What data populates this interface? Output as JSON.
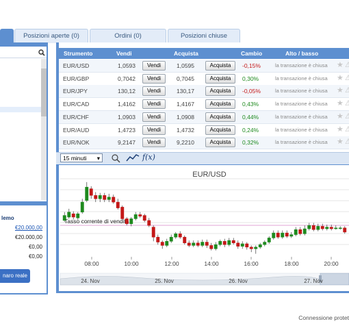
{
  "tabs": [
    "Posizioni aperte (0)",
    "Ordini (0)",
    "Posizioni chiuse"
  ],
  "table": {
    "headers": [
      "Strumento",
      "Vendi",
      "Acquista",
      "Cambio",
      "Alto / basso"
    ],
    "sell_label": "Vendi",
    "buy_label": "Acquista",
    "rows": [
      {
        "symbol": "EUR/USD",
        "sell": "1,0593",
        "buy": "1,0595",
        "change": "-0,15%",
        "note": "la transazione è chiusa"
      },
      {
        "symbol": "EUR/GBP",
        "sell": "0,7042",
        "buy": "0,7045",
        "change": "0,30%",
        "note": "la transazione è chiusa"
      },
      {
        "symbol": "EUR/JPY",
        "sell": "130,12",
        "buy": "130,17",
        "change": "-0,05%",
        "note": "la transazione è chiusa"
      },
      {
        "symbol": "EUR/CAD",
        "sell": "1,4162",
        "buy": "1,4167",
        "change": "0,43%",
        "note": "la transazione è chiusa"
      },
      {
        "symbol": "EUR/CHF",
        "sell": "1,0903",
        "buy": "1,0908",
        "change": "0,44%",
        "note": "la transazione è chiusa"
      },
      {
        "symbol": "EUR/AUD",
        "sell": "1,4723",
        "buy": "1,4732",
        "change": "0,24%",
        "note": "la transazione è chiusa"
      },
      {
        "symbol": "EUR/NOK",
        "sell": "9,2147",
        "buy": "9,2210",
        "change": "0,32%",
        "note": "la transazione è chiusa"
      }
    ]
  },
  "chart_toolbar": {
    "timeframe": "15 minuti",
    "indicator_label": "f(x)"
  },
  "chart": {
    "title": "EUR/USD",
    "current_rate_label": "Tasso corrente di vendita",
    "time_labels": [
      "08:00",
      "10:00",
      "12:00",
      "14:00",
      "16:00",
      "18:00",
      "20:00"
    ],
    "navigator_dates": [
      "24. Nov",
      "25. Nov",
      "26. Nov",
      "27. Nov"
    ]
  },
  "account": {
    "label_partial": "lemo",
    "values": [
      "€20.000,00",
      "€20.000,00",
      "€0,00",
      "€0,00"
    ],
    "real_button": "naro reale"
  },
  "footer": "Connessione protet",
  "colors": {
    "up": "#1e8a1e",
    "down": "#c41818",
    "header": "#5d8fd0"
  },
  "chart_data": {
    "type": "candlestick",
    "title": "EUR/USD",
    "x_ticks": [
      "08:00",
      "10:00",
      "12:00",
      "14:00",
      "16:00",
      "18:00",
      "20:00"
    ],
    "candles": [
      {
        "o": 0.3,
        "c": 0.36,
        "h": 0.4,
        "l": 0.28
      },
      {
        "o": 0.34,
        "c": 0.4,
        "h": 0.44,
        "l": 0.32
      },
      {
        "o": 0.38,
        "c": 0.34,
        "h": 0.41,
        "l": 0.31
      },
      {
        "o": 0.33,
        "c": 0.38,
        "h": 0.4,
        "l": 0.31
      },
      {
        "o": 0.4,
        "c": 0.52,
        "h": 0.56,
        "l": 0.38
      },
      {
        "o": 0.54,
        "c": 0.7,
        "h": 0.76,
        "l": 0.52
      },
      {
        "o": 0.68,
        "c": 0.6,
        "h": 0.71,
        "l": 0.56
      },
      {
        "o": 0.6,
        "c": 0.56,
        "h": 0.64,
        "l": 0.52
      },
      {
        "o": 0.56,
        "c": 0.6,
        "h": 0.63,
        "l": 0.52
      },
      {
        "o": 0.6,
        "c": 0.55,
        "h": 0.63,
        "l": 0.52
      },
      {
        "o": 0.55,
        "c": 0.58,
        "h": 0.62,
        "l": 0.52
      },
      {
        "o": 0.58,
        "c": 0.52,
        "h": 0.61,
        "l": 0.5
      },
      {
        "o": 0.52,
        "c": 0.45,
        "h": 0.56,
        "l": 0.43
      },
      {
        "o": 0.46,
        "c": 0.32,
        "h": 0.48,
        "l": 0.3
      },
      {
        "o": 0.32,
        "c": 0.26,
        "h": 0.34,
        "l": 0.24
      },
      {
        "o": 0.26,
        "c": 0.32,
        "h": 0.34,
        "l": 0.23
      },
      {
        "o": 0.32,
        "c": 0.37,
        "h": 0.4,
        "l": 0.3
      },
      {
        "o": 0.37,
        "c": 0.35,
        "h": 0.4,
        "l": 0.33
      },
      {
        "o": 0.36,
        "c": 0.3,
        "h": 0.38,
        "l": 0.28
      },
      {
        "o": 0.3,
        "c": 0.24,
        "h": 0.33,
        "l": 0.22
      },
      {
        "o": 0.22,
        "c": 0.1,
        "h": 0.24,
        "l": 0.05
      },
      {
        "o": 0.1,
        "c": 0.04,
        "h": 0.13,
        "l": 0.01
      },
      {
        "o": 0.04,
        "c": 0.0,
        "h": 0.06,
        "l": -0.04
      },
      {
        "o": 0.0,
        "c": 0.05,
        "h": 0.08,
        "l": -0.02
      },
      {
        "o": 0.05,
        "c": 0.1,
        "h": 0.13,
        "l": 0.03
      },
      {
        "o": 0.1,
        "c": 0.14,
        "h": 0.16,
        "l": 0.08
      },
      {
        "o": 0.14,
        "c": 0.1,
        "h": 0.17,
        "l": 0.08
      },
      {
        "o": 0.1,
        "c": 0.03,
        "h": 0.12,
        "l": 0.01
      },
      {
        "o": 0.03,
        "c": 0.0,
        "h": 0.06,
        "l": -0.02
      },
      {
        "o": 0.0,
        "c": 0.03,
        "h": 0.06,
        "l": -0.02
      },
      {
        "o": 0.03,
        "c": 0.0,
        "h": 0.06,
        "l": -0.02
      },
      {
        "o": 0.0,
        "c": 0.04,
        "h": 0.07,
        "l": -0.02
      },
      {
        "o": 0.04,
        "c": 0.0,
        "h": 0.07,
        "l": -0.03
      },
      {
        "o": 0.0,
        "c": -0.04,
        "h": 0.03,
        "l": -0.06
      },
      {
        "o": -0.04,
        "c": 0.01,
        "h": 0.04,
        "l": -0.06
      },
      {
        "o": 0.01,
        "c": 0.05,
        "h": 0.07,
        "l": -0.01
      },
      {
        "o": 0.05,
        "c": 0.01,
        "h": 0.08,
        "l": -0.02
      },
      {
        "o": 0.01,
        "c": 0.06,
        "h": 0.09,
        "l": -0.01
      },
      {
        "o": 0.06,
        "c": 0.03,
        "h": 0.09,
        "l": 0.01
      },
      {
        "o": 0.03,
        "c": -0.01,
        "h": 0.06,
        "l": -0.04
      },
      {
        "o": -0.01,
        "c": 0.02,
        "h": 0.05,
        "l": -0.04
      },
      {
        "o": 0.02,
        "c": -0.02,
        "h": 0.04,
        "l": -0.05
      },
      {
        "o": -0.02,
        "c": -0.04,
        "h": 0.0,
        "l": -0.08
      },
      {
        "o": -0.04,
        "c": -0.02,
        "h": 0.0,
        "l": -0.1
      },
      {
        "o": -0.02,
        "c": 0.01,
        "h": 0.03,
        "l": -0.04
      },
      {
        "o": 0.01,
        "c": 0.04,
        "h": 0.06,
        "l": -0.01
      },
      {
        "o": 0.04,
        "c": 0.09,
        "h": 0.11,
        "l": 0.02
      },
      {
        "o": 0.09,
        "c": 0.15,
        "h": 0.18,
        "l": 0.07
      },
      {
        "o": 0.15,
        "c": 0.1,
        "h": 0.18,
        "l": 0.08
      },
      {
        "o": 0.1,
        "c": 0.15,
        "h": 0.18,
        "l": 0.08
      },
      {
        "o": 0.15,
        "c": 0.11,
        "h": 0.18,
        "l": 0.09
      },
      {
        "o": 0.11,
        "c": 0.13,
        "h": 0.16,
        "l": 0.09
      },
      {
        "o": 0.13,
        "c": 0.19,
        "h": 0.22,
        "l": 0.11
      },
      {
        "o": 0.19,
        "c": 0.14,
        "h": 0.22,
        "l": 0.12
      },
      {
        "o": 0.14,
        "c": 0.2,
        "h": 0.24,
        "l": 0.12
      },
      {
        "o": 0.2,
        "c": 0.24,
        "h": 0.27,
        "l": 0.18
      },
      {
        "o": 0.24,
        "c": 0.19,
        "h": 0.27,
        "l": 0.17
      },
      {
        "o": 0.19,
        "c": 0.23,
        "h": 0.26,
        "l": 0.17
      },
      {
        "o": 0.23,
        "c": 0.2,
        "h": 0.26,
        "l": 0.18
      },
      {
        "o": 0.2,
        "c": 0.22,
        "h": 0.25,
        "l": 0.18
      },
      {
        "o": 0.22,
        "c": 0.2,
        "h": 0.25,
        "l": 0.18
      },
      {
        "o": 0.2,
        "c": 0.21,
        "h": 0.24,
        "l": 0.19
      },
      {
        "o": 0.21,
        "c": 0.21,
        "h": 0.23,
        "l": 0.19
      },
      {
        "o": 0.21,
        "c": 0.16,
        "h": 0.23,
        "l": 0.14
      }
    ]
  }
}
